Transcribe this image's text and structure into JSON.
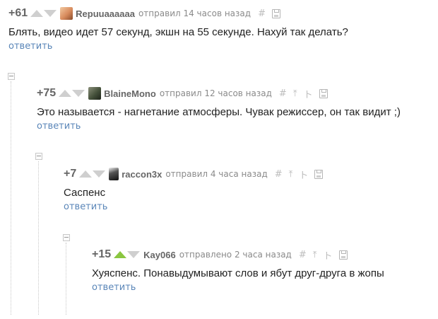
{
  "comments": [
    {
      "rating": "+61",
      "user": "Repuuaaaaaa",
      "meta": "отправил 14 часов назад",
      "text": "Блять, видео идет 57 секунд, экшн на 55 секунде. Нахуй так делать?",
      "reply_label": "ответить",
      "vote_up_active": false
    },
    {
      "rating": "+75",
      "user": "BlaineMono",
      "meta": "отправил 12 часов назад",
      "text": "Это называется - нагнетание атмосферы. Чувак режиссер, он так видит ;)",
      "reply_label": "ответить",
      "vote_up_active": false
    },
    {
      "rating": "+7",
      "user": "raccon3x",
      "meta": "отправил 4 часа назад",
      "text": "Саспенс",
      "reply_label": "ответить",
      "vote_up_active": false
    },
    {
      "rating": "+15",
      "user": "Kay066",
      "meta": "отправлено 2 часа назад",
      "text": "Хуяспенс. Понавыдумывают слов и ябут друг-друга в жопы",
      "reply_label": "ответить",
      "vote_up_active": true
    }
  ],
  "icons": {
    "link": "#",
    "parent": "⤒",
    "thread": "ト",
    "save": "save-icon"
  },
  "colors": {
    "link": "#5a86b8",
    "vote_up_active": "#8ac640",
    "vote_inactive": "#cfcfcf",
    "meta": "#8a8a8a"
  }
}
